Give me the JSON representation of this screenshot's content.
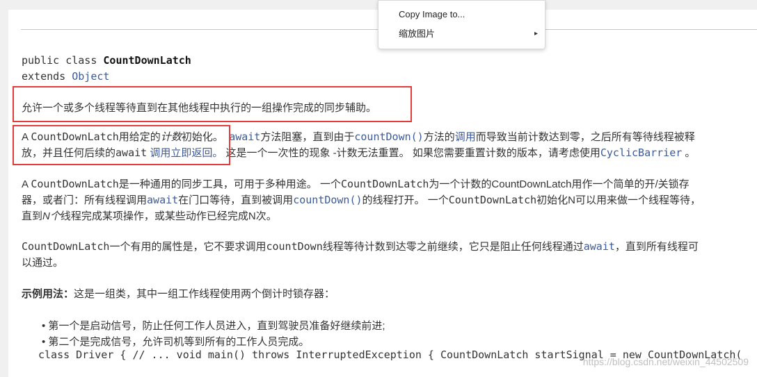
{
  "doc": {
    "signature": {
      "line1_kw": "public class ",
      "line1_name": "CountDownLatch",
      "line2_kw": "extends ",
      "line2_link": "Object"
    },
    "summary": "允许一个或多个线程等待直到在其他线程中执行的一组操作完成的同步辅助。",
    "p2": {
      "l1_a": "A ",
      "l1_b": "CountDownLatch",
      "l1_c": "用给定的",
      "l1_d": "计数",
      "l1_e": "初始化。",
      "l1_f": "await",
      "l1_g": "方法阻塞，直到由于",
      "l1_h": "countDown()",
      "l1_i": "方法的",
      "l1_j": "调用",
      "l1_k": "而导致当前计数达到零，之后所有等待线程被释",
      "l2_a": "放，并且任何后续的",
      "l2_b": "await",
      "l2_c": " 调用立即返回。",
      "l2_d": " 这是一个一次性的现象 -计数无法重置。 如果您需要重置计数的版本，请考虑使用",
      "l2_e": "CyclicBarrier",
      "l2_f": " 。"
    },
    "p3": {
      "l1_a": "A ",
      "l1_b": "CountDownLatch",
      "l1_c": "是一种通用的同步工具，可用于多种用途。 一个",
      "l1_d": "CountDownLatch",
      "l1_e": "为一个计数的CountDownLatch用作一个简单的开/关锁存",
      "l2_a": "器，或者门：所有线程调用",
      "l2_b": "await",
      "l2_c": "在门口等待，直到被调用",
      "l2_d": "countDown()",
      "l2_e": "的线程打开。 一个",
      "l2_f": "CountDownLatch",
      "l2_g": "初始化N可以用来做一个线程等待，",
      "l3_a": "直到",
      "l3_b": "N个",
      "l3_c": "线程完成某项操作，或某些动作已经完成N次。"
    },
    "p4": {
      "l1_a": "CountDownLatch",
      "l1_b": "一个有用的属性是，它不要求调用",
      "l1_c": "countDown",
      "l1_d": "线程等待计数到达零之前继续，它只是阻止任何线程通过",
      "l1_e": "await",
      "l1_f": "，直到所有线程可",
      "l2": "以通过。"
    },
    "p5": {
      "bold": "示例用法：",
      "rest": "这是一组类，其中一组工作线程使用两个倒计时锁存器："
    },
    "bullets": [
      "第一个是启动信号，防止任何工作人员进入，直到驾驶员准备好继续前进;",
      "第二个是完成信号，允许司机等到所有的工作人员完成。"
    ],
    "code": "class Driver { // ... void main() throws InterruptedException { CountDownLatch startSignal = new CountDownLatch(",
    "watermark": "https://blog.csdn.net/weixin_44502509"
  },
  "context_menu": {
    "items": [
      {
        "label": "Copy Image to..."
      },
      {
        "label": "缩放图片",
        "submenu": true,
        "arrow": "▸"
      }
    ]
  },
  "colors": {
    "highlight_border": "#e23b3b",
    "link": "#3c5a99",
    "text": "#333333"
  }
}
